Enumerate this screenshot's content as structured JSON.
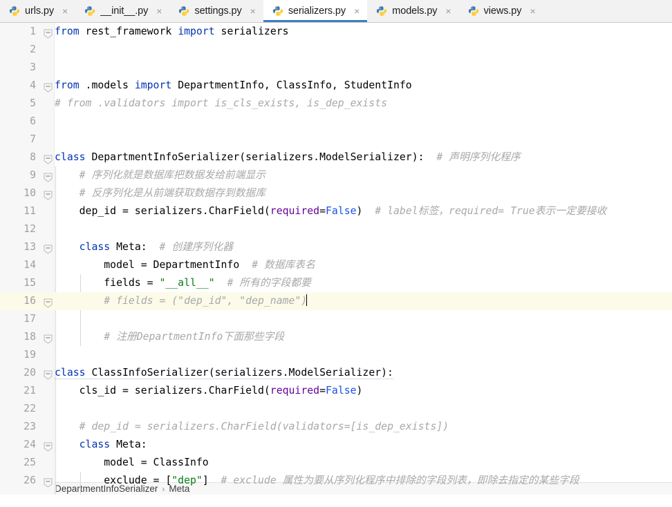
{
  "window": {
    "app": "PyCharm Editor",
    "accent_color": "#3d7ec4",
    "editor_bg": "#ffffff",
    "gutter_bg": "#f7f7f7",
    "current_line_bg": "#fcfae9"
  },
  "tabs": [
    {
      "label": "urls.py",
      "icon": "python-file-icon",
      "active": false,
      "close": "×"
    },
    {
      "label": "__init__.py",
      "icon": "python-file-icon",
      "active": false,
      "close": "×"
    },
    {
      "label": "settings.py",
      "icon": "python-file-icon",
      "active": false,
      "close": "×"
    },
    {
      "label": "serializers.py",
      "icon": "python-file-icon",
      "active": true,
      "close": "×"
    },
    {
      "label": "models.py",
      "icon": "python-file-icon",
      "active": false,
      "close": "×"
    },
    {
      "label": "views.py",
      "icon": "python-file-icon",
      "active": false,
      "close": "×"
    }
  ],
  "editor": {
    "language": "Python",
    "current_line": 16,
    "first_line": 1,
    "last_line": 26,
    "line_numbers": [
      1,
      2,
      3,
      4,
      5,
      6,
      7,
      8,
      9,
      10,
      11,
      12,
      13,
      14,
      15,
      16,
      17,
      18,
      19,
      20,
      21,
      22,
      23,
      24,
      25,
      26
    ],
    "fold_lines": [
      1,
      4,
      8,
      9,
      10,
      13,
      16,
      18,
      20,
      24,
      26
    ],
    "lines": [
      {
        "n": 1,
        "text": "from rest_framework import serializers"
      },
      {
        "n": 2,
        "text": ""
      },
      {
        "n": 3,
        "text": ""
      },
      {
        "n": 4,
        "text": "from .models import DepartmentInfo, ClassInfo, StudentInfo"
      },
      {
        "n": 5,
        "text": "# from .validators import is_cls_exists, is_dep_exists"
      },
      {
        "n": 6,
        "text": ""
      },
      {
        "n": 7,
        "text": ""
      },
      {
        "n": 8,
        "text": "class DepartmentInfoSerializer(serializers.ModelSerializer):  # 声明序列化程序"
      },
      {
        "n": 9,
        "text": "    # 序列化就是数据库把数据发给前端显示"
      },
      {
        "n": 10,
        "text": "    # 反序列化是从前端获取数据存到数据库"
      },
      {
        "n": 11,
        "text": "    dep_id = serializers.CharField(required=False)  # label标签，required= True表示一定要接收"
      },
      {
        "n": 12,
        "text": ""
      },
      {
        "n": 13,
        "text": "    class Meta:  # 创建序列化器"
      },
      {
        "n": 14,
        "text": "        model = DepartmentInfo  # 数据库表名"
      },
      {
        "n": 15,
        "text": "        fields = \"__all__\"  # 所有的字段都要"
      },
      {
        "n": 16,
        "text": "        # fields = (\"dep_id\", \"dep_name\")"
      },
      {
        "n": 17,
        "text": ""
      },
      {
        "n": 18,
        "text": "        # 注册DepartmentInfo下面那些字段"
      },
      {
        "n": 19,
        "text": ""
      },
      {
        "n": 20,
        "text": "class ClassInfoSerializer(serializers.ModelSerializer):"
      },
      {
        "n": 21,
        "text": "    cls_id = serializers.CharField(required=False)"
      },
      {
        "n": 22,
        "text": ""
      },
      {
        "n": 23,
        "text": "    # dep_id = serializers.CharField(validators=[is_dep_exists])"
      },
      {
        "n": 24,
        "text": "    class Meta:"
      },
      {
        "n": 25,
        "text": "        model = ClassInfo"
      },
      {
        "n": 26,
        "text": "        exclude = [\"dep\"]  # exclude 属性为要从序列化程序中排除的字段列表，即除去指定的某些字段"
      }
    ],
    "tokens": {
      "l1": [
        [
          "from ",
          "kw"
        ],
        [
          "rest_framework ",
          "def"
        ],
        [
          "import ",
          "kw"
        ],
        [
          "serializers",
          "def"
        ]
      ],
      "l4": [
        [
          "from ",
          "kw"
        ],
        [
          ".models ",
          "def"
        ],
        [
          "import ",
          "kw"
        ],
        [
          "DepartmentInfo, ClassInfo, StudentInfo",
          "def"
        ]
      ],
      "l5": [
        [
          "# from .validators import is_cls_exists, is_dep_exists",
          "cmt"
        ]
      ],
      "l8": [
        [
          "class ",
          "kw"
        ],
        [
          "DepartmentInfoSerializer(serializers.ModelSerializer):",
          "def"
        ],
        [
          "  # 声明序列化程序",
          "cmt"
        ]
      ],
      "l9": [
        [
          "    ",
          "def"
        ],
        [
          "# 序列化就是数据库把数据发给前端显示",
          "cmt"
        ]
      ],
      "l10": [
        [
          "    ",
          "def"
        ],
        [
          "# 反序列化是从前端获取数据存到数据库",
          "cmt"
        ]
      ],
      "l11": [
        [
          "    dep_id = serializers.CharField(",
          "def"
        ],
        [
          "required",
          "kwarg"
        ],
        [
          "=",
          "def"
        ],
        [
          "False",
          "num"
        ],
        [
          ")",
          "def"
        ],
        [
          "  # label标签，required= True表示一定要接收",
          "cmt"
        ]
      ],
      "l13": [
        [
          "    ",
          "def"
        ],
        [
          "class ",
          "kw"
        ],
        [
          "Meta:",
          "def"
        ],
        [
          "  # 创建序列化器",
          "cmt"
        ]
      ],
      "l14": [
        [
          "        model = DepartmentInfo",
          "def"
        ],
        [
          "  # 数据库表名",
          "cmt"
        ]
      ],
      "l15": [
        [
          "        fields = ",
          "def"
        ],
        [
          "\"__all__\"",
          "str"
        ],
        [
          "  # 所有的字段都要",
          "cmt"
        ]
      ],
      "l16": [
        [
          "        ",
          "def"
        ],
        [
          "# fields = (\"dep_id\", \"dep_name\")",
          "cmt"
        ]
      ],
      "l18": [
        [
          "        ",
          "def"
        ],
        [
          "# 注册DepartmentInfo下面那些字段",
          "cmt"
        ]
      ],
      "l20": [
        [
          "class ",
          "kw"
        ],
        [
          "ClassInfoSerializer(serializers.ModelSerializer):",
          "def"
        ]
      ],
      "l21": [
        [
          "    cls_id = serializers.CharField(",
          "def"
        ],
        [
          "required",
          "kwarg"
        ],
        [
          "=",
          "def"
        ],
        [
          "False",
          "num"
        ],
        [
          ")",
          "def"
        ]
      ],
      "l23": [
        [
          "    ",
          "def"
        ],
        [
          "# dep_id = serializers.CharField(validators=[is_dep_exists])",
          "cmt"
        ]
      ],
      "l24": [
        [
          "    ",
          "def"
        ],
        [
          "class ",
          "kw"
        ],
        [
          "Meta:",
          "def"
        ]
      ],
      "l25": [
        [
          "        model = ClassInfo",
          "def"
        ]
      ],
      "l26": [
        [
          "        exclude = [",
          "def"
        ],
        [
          "\"dep\"",
          "str"
        ],
        [
          "]",
          "def"
        ],
        [
          "  # exclude 属性为要从序列化程序中排除的字段列表，即除去指定的某些字段",
          "cmt"
        ]
      ]
    }
  },
  "breadcrumb": {
    "items": [
      "DepartmentInfoSerializer",
      "Meta"
    ],
    "separator": "›"
  }
}
